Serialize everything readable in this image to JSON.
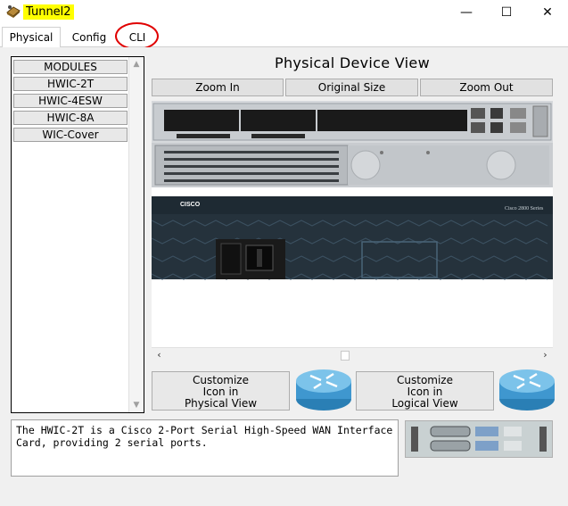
{
  "window": {
    "title": "Tunnel2",
    "minimize_glyph": "—",
    "maximize_glyph": "☐",
    "close_glyph": "✕"
  },
  "tabs": [
    {
      "label": "Physical",
      "active": true
    },
    {
      "label": "Config",
      "active": false
    },
    {
      "label": "CLI",
      "active": false,
      "highlighted": true
    }
  ],
  "modules": {
    "items": [
      "MODULES",
      "HWIC-2T",
      "HWIC-4ESW",
      "HWIC-8A",
      "WIC-Cover"
    ]
  },
  "physical_view": {
    "title": "Physical Device View",
    "zoom_in": "Zoom In",
    "original_size": "Original Size",
    "zoom_out": "Zoom Out",
    "brand_text": "CISCO",
    "series_text": "Cisco 2800 Series"
  },
  "customize": {
    "physical_line1": "Customize",
    "physical_line2": "Icon in",
    "physical_line3": "Physical View",
    "logical_line1": "Customize",
    "logical_line2": "Icon in",
    "logical_line3": "Logical View"
  },
  "description": {
    "text": "The HWIC-2T is a Cisco 2-Port Serial High-Speed WAN Interface Card, providing 2 serial ports."
  },
  "colors": {
    "title_highlight": "#ffff00",
    "annotation_circle": "#e00000",
    "router_blue": "#4fa7d8",
    "chassis_dark": "#1e2a33"
  }
}
